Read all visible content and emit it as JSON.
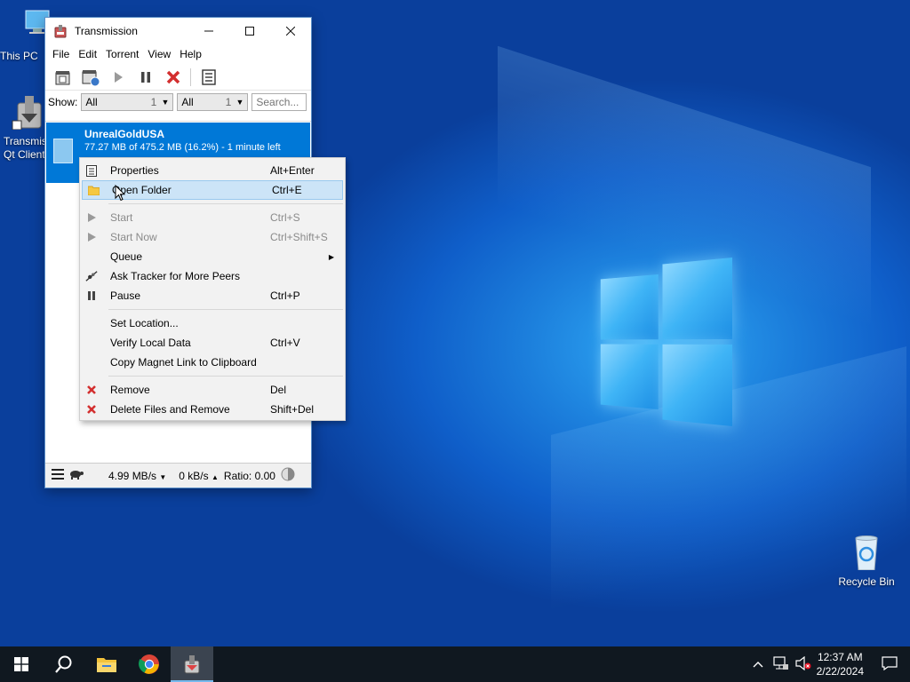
{
  "desktop": {
    "icons": [
      {
        "label": "This PC"
      },
      {
        "label": "Transmission Qt Client"
      },
      {
        "label": "Recycle Bin"
      }
    ]
  },
  "window": {
    "title": "Transmission",
    "menu": [
      "File",
      "Edit",
      "Torrent",
      "View",
      "Help"
    ],
    "filter": {
      "show_label": "Show:",
      "activity": {
        "value": "All",
        "count": "1"
      },
      "tracker": {
        "value": "All",
        "count": "1"
      },
      "search_placeholder": "Search..."
    },
    "torrent": {
      "name": "UnrealGoldUSA",
      "progress_text": "77.27 MB of 475.2 MB (16.2%) - 1 minute left",
      "progress_percent": 16.2
    },
    "statusbar": {
      "down_speed": "4.99 MB/s",
      "up_speed": "0 kB/s",
      "ratio": "Ratio: 0.00"
    }
  },
  "context_menu": {
    "items": [
      {
        "label": "Properties",
        "shortcut": "Alt+Enter"
      },
      {
        "label": "Open Folder",
        "shortcut": "Ctrl+E"
      },
      {
        "label": "Start",
        "shortcut": "Ctrl+S"
      },
      {
        "label": "Start Now",
        "shortcut": "Ctrl+Shift+S"
      },
      {
        "label": "Queue",
        "shortcut": ""
      },
      {
        "label": "Ask Tracker for More Peers",
        "shortcut": ""
      },
      {
        "label": "Pause",
        "shortcut": "Ctrl+P"
      },
      {
        "label": "Set Location...",
        "shortcut": ""
      },
      {
        "label": "Verify Local Data",
        "shortcut": "Ctrl+V"
      },
      {
        "label": "Copy Magnet Link to Clipboard",
        "shortcut": ""
      },
      {
        "label": "Remove",
        "shortcut": "Del"
      },
      {
        "label": "Delete Files and Remove",
        "shortcut": "Shift+Del"
      }
    ]
  },
  "taskbar": {
    "time": "12:37 AM",
    "date": "2/22/2024"
  },
  "colors": {
    "selection": "#0078d7",
    "menu_highlight": "#cce4f7",
    "remove_red": "#d32f2f"
  }
}
